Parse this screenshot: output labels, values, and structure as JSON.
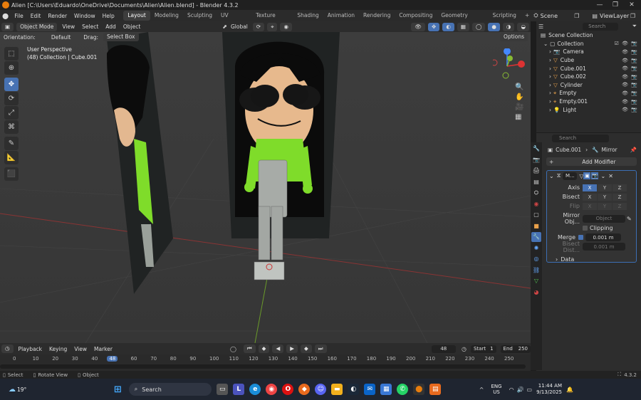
{
  "window": {
    "title": "Alien [C:\\Users\\Eduardo\\OneDrive\\Documents\\Alien\\Alien.blend] - Blender 4.3.2"
  },
  "menu": [
    "File",
    "Edit",
    "Render",
    "Window",
    "Help"
  ],
  "workspaces": [
    "Layout",
    "Modeling",
    "Sculpting",
    "UV Editing",
    "Texture Paint",
    "Shading",
    "Animation",
    "Rendering",
    "Compositing",
    "Geometry Nodes",
    "Scripting"
  ],
  "scene": {
    "label": "Scene",
    "viewlayer": "ViewLayer"
  },
  "viewport_header": {
    "mode": "Object Mode",
    "menus": [
      "View",
      "Select",
      "Add",
      "Object"
    ],
    "transform": "Global",
    "options": "Options"
  },
  "viewport_sub": {
    "orientation_label": "Orientation:",
    "orientation": "Default",
    "drag_label": "Drag:",
    "drag": "Select Box"
  },
  "overlay": {
    "perspective": "User Perspective",
    "collection": "(48) Collection | Cube.001"
  },
  "outliner": {
    "search_placeholder": "Search",
    "items": [
      {
        "name": "Scene Collection",
        "color": "#ddd"
      },
      {
        "name": "Collection",
        "color": "#ddd"
      },
      {
        "name": "Camera",
        "color": "#ddd"
      },
      {
        "name": "Cube",
        "color": "#ddd"
      },
      {
        "name": "Cube.001",
        "color": "#ddd"
      },
      {
        "name": "Cube.002",
        "color": "#ddd"
      },
      {
        "name": "Cylinder",
        "color": "#ddd"
      },
      {
        "name": "Empty",
        "color": "#ddd"
      },
      {
        "name": "Empty.001",
        "color": "#ddd"
      },
      {
        "name": "Light",
        "color": "#ddd"
      }
    ]
  },
  "properties": {
    "search_placeholder": "Search",
    "object": "Cube.001",
    "modifier_crumb": "Mirror",
    "add_modifier": "Add Modifier",
    "modifier_name": "M...",
    "axis_label": "Axis",
    "bisect_label": "Bisect",
    "flip_label": "Flip",
    "x": "X",
    "y": "Y",
    "z": "Z",
    "mirror_obj_label": "Mirror Obj...",
    "object_placeholder": "Object",
    "clipping": "Clipping",
    "merge": "Merge",
    "merge_value": "0.001 m",
    "bisect_dist_label": "Bisect Dist...",
    "bisect_dist_value": "0.001 m",
    "data": "Data"
  },
  "timeline": {
    "menus": [
      "Playback",
      "Keying",
      "View",
      "Marker"
    ],
    "current": "48",
    "start_label": "Start",
    "start": "1",
    "end_label": "End",
    "end": "250",
    "ticks": [
      "0",
      "10",
      "20",
      "30",
      "40",
      "48",
      "60",
      "70",
      "80",
      "90",
      "100",
      "110",
      "120",
      "130",
      "140",
      "150",
      "160",
      "170",
      "180",
      "190",
      "200",
      "210",
      "220",
      "230",
      "240",
      "250"
    ]
  },
  "status": {
    "select": "Select",
    "rotate": "Rotate View",
    "object": "Object",
    "version": "4.3.2"
  },
  "taskbar": {
    "weather": "19°",
    "search": "Search",
    "lang": "ENG",
    "region": "US",
    "time": "11:44 AM",
    "date": "9/13/2025"
  }
}
